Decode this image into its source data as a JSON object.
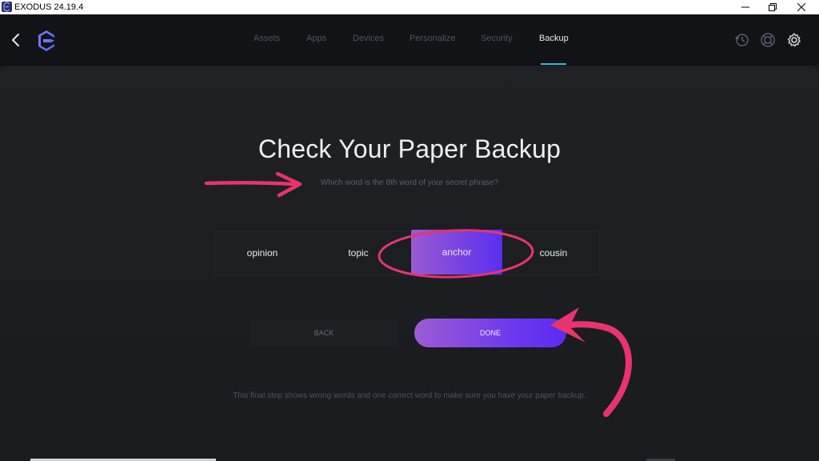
{
  "window": {
    "title": "EXODUS 24.19.4"
  },
  "nav": {
    "tabs": [
      {
        "label": "Assets"
      },
      {
        "label": "Apps"
      },
      {
        "label": "Devices"
      },
      {
        "label": "Personalize"
      },
      {
        "label": "Security"
      },
      {
        "label": "Backup"
      }
    ],
    "active_tab": "Backup"
  },
  "main": {
    "heading": "Check Your Paper Backup",
    "question": "Which word is the 8th word of your secret phrase?",
    "words": [
      "opinion",
      "topic",
      "anchor",
      "cousin"
    ],
    "selected_word": "anchor",
    "back_label": "BACK",
    "done_label": "DONE",
    "note": "This final step shows wrong words and one correct word to make sure you have your paper backup."
  },
  "colors": {
    "accent_purple": "#5a2ef0",
    "accent_violet": "#9a5ad1",
    "annotation_pink": "#e8336f",
    "tab_underline": "#2fb9e6"
  }
}
